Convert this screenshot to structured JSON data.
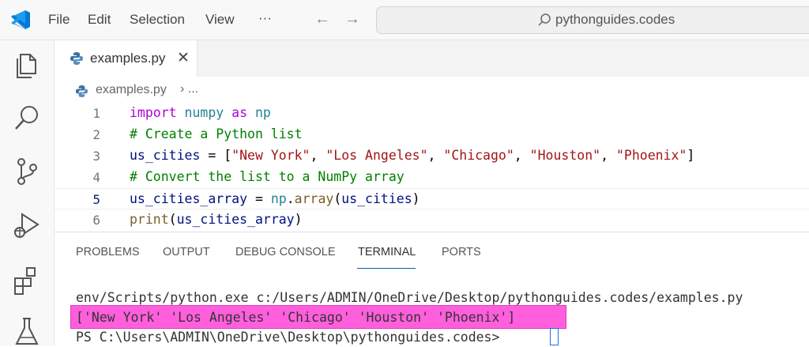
{
  "menu": {
    "file": "File",
    "edit": "Edit",
    "selection": "Selection",
    "view": "View",
    "more": "···"
  },
  "search": {
    "text": "pythonguides.codes"
  },
  "tab": {
    "label": "examples.py",
    "close": "✕"
  },
  "breadcrumb": {
    "file": "examples.py",
    "separator": "› ..."
  },
  "editor": {
    "current_line": 5,
    "lines": [
      {
        "n": "1",
        "text": "import numpy as np"
      },
      {
        "n": "2",
        "text": "# Create a Python list"
      },
      {
        "n": "3",
        "text": "us_cities = [\"New York\", \"Los Angeles\", \"Chicago\", \"Houston\", \"Phoenix\"]"
      },
      {
        "n": "4",
        "text": "# Convert the list to a NumPy array"
      },
      {
        "n": "5",
        "text": "us_cities_array = np.array(us_cities)"
      },
      {
        "n": "6",
        "text": "print(us_cities_array)"
      }
    ]
  },
  "panel": {
    "tabs": [
      "PROBLEMS",
      "OUTPUT",
      "DEBUG CONSOLE",
      "TERMINAL",
      "PORTS"
    ],
    "active_tab": "TERMINAL"
  },
  "terminal": {
    "line1": "env/Scripts/python.exe c:/Users/ADMIN/OneDrive/Desktop/pythonguides.codes/examples.py",
    "line2": "['New York' 'Los Angeles' 'Chicago' 'Houston' 'Phoenix']",
    "line3": "PS C:\\Users\\ADMIN\\OneDrive\\Desktop\\pythonguides.codes> "
  },
  "colors": {
    "accent": "#005fb8",
    "highlight": "#ff5fdc",
    "keyword": "#af00db",
    "string": "#a31515",
    "comment": "#008000"
  }
}
